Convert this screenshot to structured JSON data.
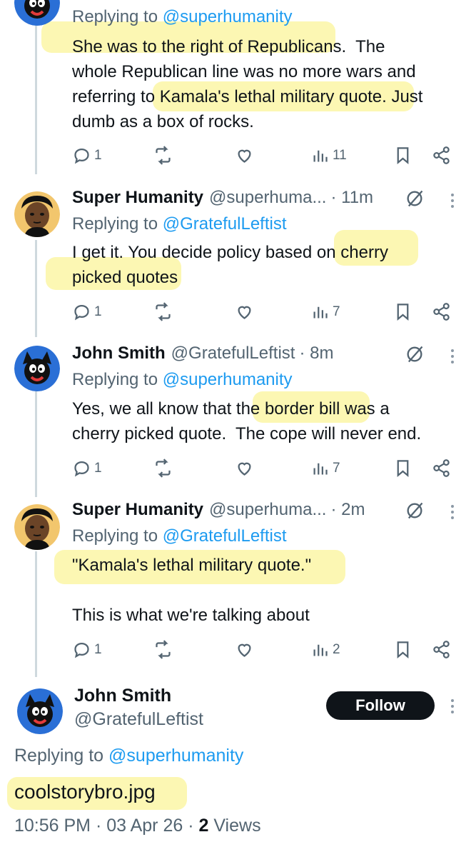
{
  "colors": {
    "accent": "#1d9bf0",
    "text": "#0f1419",
    "muted": "#536471",
    "highlight": "#fbf6a6",
    "button": "#0f1419"
  },
  "tweets": [
    {
      "name": "",
      "handle": "",
      "time": "",
      "replying_label": "Replying to ",
      "replying_handle": "@superhumanity",
      "text": "She was to the right of Republicans.  The\nwhole Republican line was no more wars and\nreferring to Kamala's lethal military quote. Just\ndumb as a box of rocks.",
      "replies": "1",
      "views": "11",
      "avatar": "black-cat-avatar"
    },
    {
      "name": "Super Humanity",
      "handle": "@superhuma...",
      "time": "· 11m",
      "replying_label": "Replying to ",
      "replying_handle": "@GratefulLeftist",
      "text": "I get it. You decide policy based on cherry\npicked quotes",
      "replies": "1",
      "views": "7",
      "avatar": "cartoon-boy-avatar"
    },
    {
      "name": "John Smith",
      "handle": "@GratefulLeftist",
      "time": "· 8m",
      "replying_label": "Replying to ",
      "replying_handle": "@superhumanity",
      "text": "Yes, we all know that the border bill was a\ncherry picked quote.  The cope will never end.",
      "replies": "1",
      "views": "7",
      "avatar": "black-cat-avatar"
    },
    {
      "name": "Super Humanity",
      "handle": "@superhuma...",
      "time": "· 2m",
      "replying_label": "Replying to ",
      "replying_handle": "@GratefulLeftist",
      "text": "\"Kamala's lethal military quote.\"\n\nThis is what we're talking about",
      "replies": "1",
      "views": "2",
      "avatar": "cartoon-boy-avatar"
    }
  ],
  "main_tweet": {
    "name": "John Smith",
    "handle": "@GratefulLeftist",
    "follow_label": "Follow",
    "replying_label": "Replying to ",
    "replying_handle": "@superhumanity",
    "text": "coolstorybro.jpg",
    "timestamp": "10:56 PM · 03 Apr 26 · ",
    "views_count": "2",
    "views_label": " Views"
  }
}
